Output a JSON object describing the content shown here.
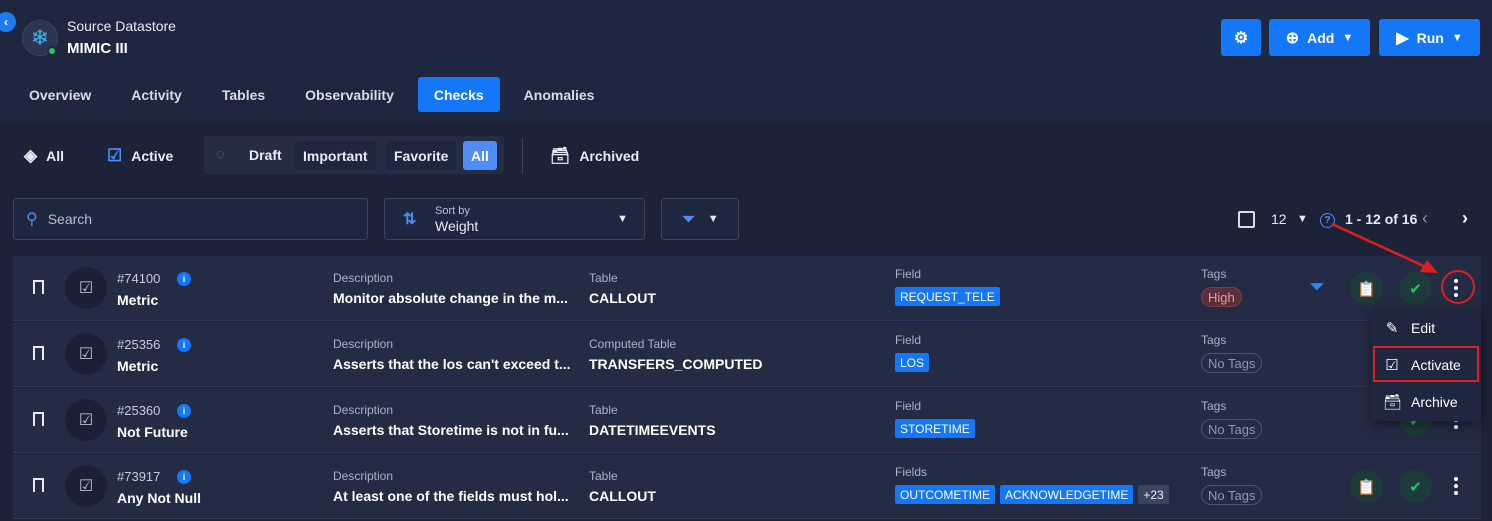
{
  "header": {
    "datastore_kind": "Source Datastore",
    "datastore_name": "MIMIC III",
    "add_label": "Add",
    "run_label": "Run"
  },
  "tabs": [
    {
      "label": "Overview",
      "active": false
    },
    {
      "label": "Activity",
      "active": false
    },
    {
      "label": "Tables",
      "active": false
    },
    {
      "label": "Observability",
      "active": false
    },
    {
      "label": "Checks",
      "active": true
    },
    {
      "label": "Anomalies",
      "active": false
    }
  ],
  "status_filters": {
    "all_label": "All",
    "active_label": "Active",
    "draft_label": "Draft",
    "important_label": "Important",
    "favorite_label": "Favorite",
    "all_chip_label": "All",
    "archived_label": "Archived"
  },
  "search": {
    "placeholder": "Search"
  },
  "sort": {
    "label": "Sort by",
    "value": "Weight"
  },
  "pagination": {
    "page_size": "12",
    "range": "1 - 12 of 16"
  },
  "rows": [
    {
      "id": "#74100",
      "type": "Metric",
      "description_label": "Description",
      "description": "Monitor absolute change in the m...",
      "table_label": "Table",
      "table": "CALLOUT",
      "field_label": "Field",
      "fields": [
        "REQUEST_TELE"
      ],
      "more_fields": "",
      "tags_label": "Tags",
      "tag": "High"
    },
    {
      "id": "#25356",
      "type": "Metric",
      "description_label": "Description",
      "description": "Asserts that the los can't exceed t...",
      "table_label": "Computed Table",
      "table": "TRANSFERS_COMPUTED",
      "field_label": "Field",
      "fields": [
        "LOS"
      ],
      "more_fields": "",
      "tags_label": "Tags",
      "tag": "No Tags"
    },
    {
      "id": "#25360",
      "type": "Not Future",
      "description_label": "Description",
      "description": "Asserts that Storetime is not in fu...",
      "table_label": "Table",
      "table": "DATETIMEEVENTS",
      "field_label": "Field",
      "fields": [
        "STORETIME"
      ],
      "more_fields": "",
      "tags_label": "Tags",
      "tag": "No Tags"
    },
    {
      "id": "#73917",
      "type": "Any Not Null",
      "description_label": "Description",
      "description": "At least one of the fields must hol...",
      "table_label": "Table",
      "table": "CALLOUT",
      "field_label": "Fields",
      "fields": [
        "OUTCOMETIME",
        "ACKNOWLEDGETIME"
      ],
      "more_fields": "+23",
      "tags_label": "Tags",
      "tag": "No Tags"
    }
  ],
  "context_menu": {
    "edit_label": "Edit",
    "activate_label": "Activate",
    "archive_label": "Archive"
  },
  "colors": {
    "accent": "#1477f8",
    "background": "#1c2338",
    "highlight": "#e11d1d"
  }
}
